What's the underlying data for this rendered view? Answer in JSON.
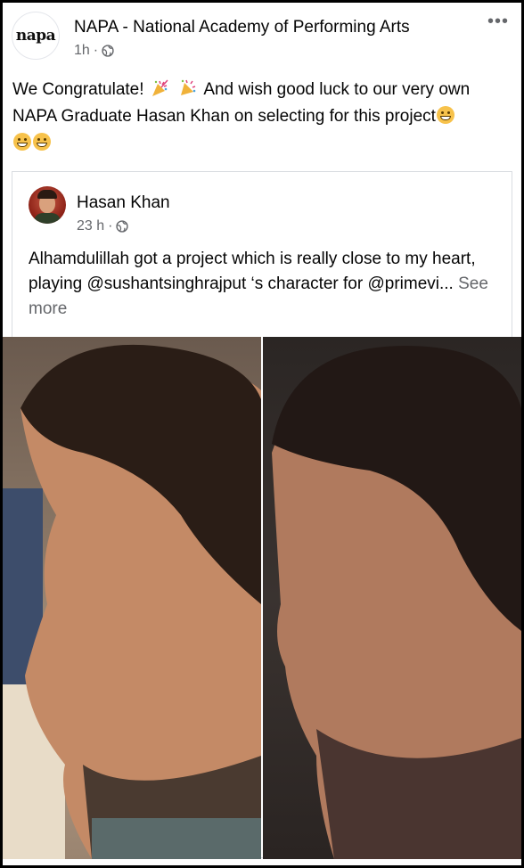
{
  "post": {
    "page_name": "NAPA - National Academy of Performing Arts",
    "avatar_text": "napa",
    "time": "1h",
    "separator": "·",
    "text_part1": "We Congratulate!",
    "text_part2": "And wish good luck to our very own NAPA Graduate Hasan Khan on selecting for this project"
  },
  "shared_post": {
    "author": "Hasan Khan",
    "time": "23 h",
    "separator": "·",
    "text": "Alhamdulillah got a project which is really close to my heart, playing @sushantsinghrajput ‘s character for @primevi...",
    "see_more": "See more"
  },
  "icons": {
    "globe": "globe-icon",
    "more": "more-options-icon",
    "emoji": "grinning-face-icon",
    "party": "party-popper-icon"
  },
  "colors": {
    "text": "#050505",
    "secondary": "#65676b",
    "border": "#dadde1"
  }
}
